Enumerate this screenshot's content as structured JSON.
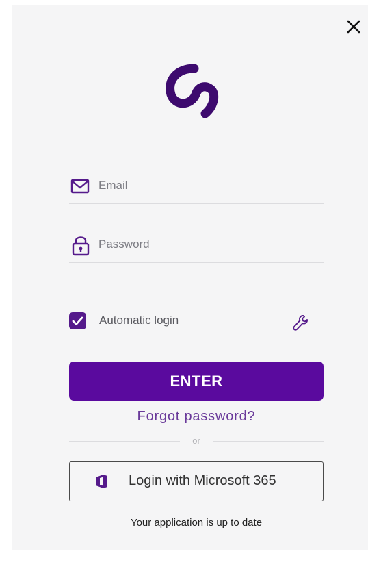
{
  "window": {
    "close_icon": "close-icon"
  },
  "logo": {
    "icon": "brand-swirl-logo",
    "color": "#3d0a6e"
  },
  "form": {
    "email": {
      "icon": "envelope-icon",
      "placeholder": "Email",
      "value": ""
    },
    "password": {
      "icon": "padlock-icon",
      "placeholder": "Password",
      "value": ""
    },
    "auto_login": {
      "label": "Automatic login",
      "checked": true
    },
    "settings_icon": "wrench-icon",
    "enter_label": "ENTER",
    "forgot_label": "Forgot password?",
    "divider_label": "or",
    "microsoft": {
      "icon": "office-icon",
      "label": "Login with Microsoft 365"
    }
  },
  "status": {
    "text": "Your application is up to date"
  },
  "colors": {
    "accent": "#5a0a9e",
    "accent_dark": "#3d0a6e",
    "link": "#6a3a9a",
    "background": "#f5f5f6"
  }
}
